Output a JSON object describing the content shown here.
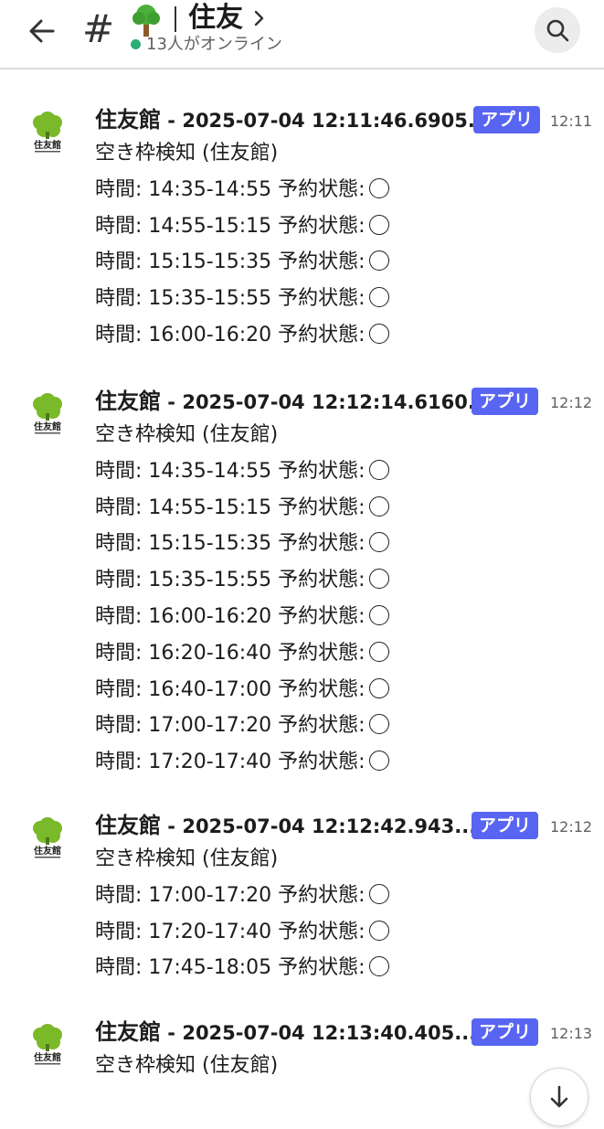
{
  "header": {
    "back_icon": "arrow-left-icon",
    "hash_symbol": "#",
    "emoji": "🌳",
    "channel_name": "住友",
    "online_status": "13人がオンライン",
    "search_icon": "search-icon"
  },
  "messages": [
    {
      "sender": "住友館",
      "subject": " - 2025-07-04 12:11:46.6905...",
      "badge": "アプリ",
      "time": "12:11",
      "title": "空き枠検知 (住友館)",
      "slots": [
        {
          "time_range": "時間: 14:35-14:55 予約状態:"
        },
        {
          "time_range": "時間: 14:55-15:15 予約状態:"
        },
        {
          "time_range": "時間: 15:15-15:35 予約状態:"
        },
        {
          "time_range": "時間: 15:35-15:55 予約状態:"
        },
        {
          "time_range": "時間: 16:00-16:20 予約状態:"
        }
      ]
    },
    {
      "sender": "住友館",
      "subject": " - 2025-07-04 12:12:14.6160...",
      "badge": "アプリ",
      "time": "12:12",
      "title": "空き枠検知 (住友館)",
      "slots": [
        {
          "time_range": "時間: 14:35-14:55 予約状態:"
        },
        {
          "time_range": "時間: 14:55-15:15 予約状態:"
        },
        {
          "time_range": "時間: 15:15-15:35 予約状態:"
        },
        {
          "time_range": "時間: 15:35-15:55 予約状態:"
        },
        {
          "time_range": "時間: 16:00-16:20 予約状態:"
        },
        {
          "time_range": "時間: 16:20-16:40 予約状態:"
        },
        {
          "time_range": "時間: 16:40-17:00 予約状態:"
        },
        {
          "time_range": "時間: 17:00-17:20 予約状態:"
        },
        {
          "time_range": "時間: 17:20-17:40 予約状態:"
        }
      ]
    },
    {
      "sender": "住友館",
      "subject": " - 2025-07-04 12:12:42.943...",
      "badge": "アプリ",
      "time": "12:12",
      "title": "空き枠検知 (住友館)",
      "slots": [
        {
          "time_range": "時間: 17:00-17:20 予約状態:"
        },
        {
          "time_range": "時間: 17:20-17:40 予約状態:"
        },
        {
          "time_range": "時間: 17:45-18:05 予約状態:"
        }
      ]
    },
    {
      "sender": "住友館",
      "subject": " - 2025-07-04 12:13:40.405...",
      "badge": "アプリ",
      "time": "12:13",
      "title": "空き枠検知 (住友館)",
      "slots": []
    }
  ],
  "avatar_text": "住友館",
  "colors": {
    "badge_bg": "#5865f2",
    "online_dot": "#2bac76",
    "avatar_tree": "#7ab929"
  }
}
